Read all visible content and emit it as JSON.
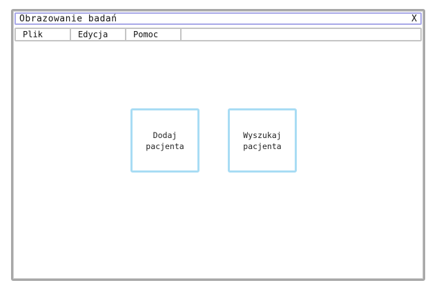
{
  "window": {
    "title": "Obrazowanie badań",
    "close_label": "X"
  },
  "menu": {
    "items": [
      {
        "label": "Plik"
      },
      {
        "label": "Edycja"
      },
      {
        "label": "Pomoc"
      }
    ]
  },
  "main": {
    "add_patient_label": "Dodaj\npacjenta",
    "search_patient_label": "Wyszukaj\npacjenta"
  },
  "colors": {
    "titlebar_border": "#a8a8e8",
    "button_border": "#a8dcf4",
    "window_border": "#a8a8a8"
  }
}
